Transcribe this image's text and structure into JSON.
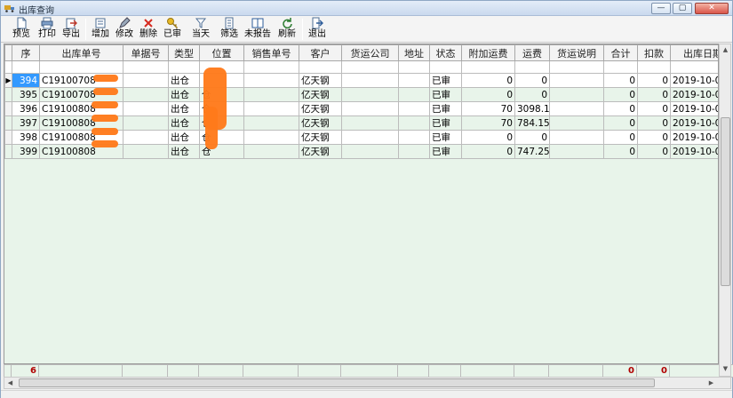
{
  "window": {
    "title": "出库查询",
    "min": "—",
    "max": "▢",
    "close": "✕"
  },
  "toolbar": {
    "preview": "预览",
    "print": "打印",
    "export": "导出",
    "add": "增加",
    "edit": "修改",
    "delete": "删除",
    "approved": "已审",
    "today": "当天",
    "filter": "筛选",
    "unreported": "未报告",
    "refresh": "刷新",
    "exit": "退出"
  },
  "colors": {
    "selection": "#3399ff",
    "row_alt": "#e8f4ea",
    "total_text": "#b00000"
  },
  "grid": {
    "headers": [
      "序",
      "出库单号",
      "单据号",
      "类型",
      "位置",
      "销售单号",
      "客户",
      "货运公司",
      "地址",
      "状态",
      "附加运费",
      "运费",
      "货运说明",
      "合计",
      "扣款",
      "出库日期"
    ],
    "rows": [
      {
        "seq": "394",
        "order": "C19100708",
        "doc": "",
        "type": "出仓",
        "loc": "",
        "sales": "",
        "customer": "亿天钢",
        "shipco": "",
        "addr": "",
        "status": "已审",
        "extra": "0",
        "freight": "0",
        "note": "",
        "total": "0",
        "deduct": "0",
        "date": "2019-10-0"
      },
      {
        "seq": "395",
        "order": "C19100708",
        "doc": "",
        "type": "出仓",
        "loc": "仓",
        "sales": "",
        "customer": "亿天钢",
        "shipco": "",
        "addr": "",
        "status": "已审",
        "extra": "0",
        "freight": "0",
        "note": "",
        "total": "0",
        "deduct": "0",
        "date": "2019-10-0"
      },
      {
        "seq": "396",
        "order": "C19100808",
        "doc": "",
        "type": "出仓",
        "loc": "仓",
        "sales": "",
        "customer": "亿天钢",
        "shipco": "",
        "addr": "",
        "status": "已审",
        "extra": "70",
        "freight": "3098.1",
        "note": "",
        "total": "0",
        "deduct": "0",
        "date": "2019-10-0"
      },
      {
        "seq": "397",
        "order": "C19100808",
        "doc": "",
        "type": "出仓",
        "loc": "仓",
        "sales": "",
        "customer": "亿天钢",
        "shipco": "",
        "addr": "",
        "status": "已审",
        "extra": "70",
        "freight": "784.15",
        "note": "",
        "total": "0",
        "deduct": "0",
        "date": "2019-10-0"
      },
      {
        "seq": "398",
        "order": "C19100808",
        "doc": "",
        "type": "出仓",
        "loc": "仓",
        "sales": "",
        "customer": "亿天钢",
        "shipco": "",
        "addr": "",
        "status": "已审",
        "extra": "0",
        "freight": "0",
        "note": "",
        "total": "0",
        "deduct": "0",
        "date": "2019-10-0"
      },
      {
        "seq": "399",
        "order": "C19100808",
        "doc": "",
        "type": "出仓",
        "loc": "仓",
        "sales": "",
        "customer": "亿天钢",
        "shipco": "",
        "addr": "",
        "status": "已审",
        "extra": "0",
        "freight": "747.25",
        "note": "",
        "total": "0",
        "deduct": "0",
        "date": "2019-10-0"
      }
    ]
  },
  "footer": {
    "count": "6",
    "total": "0",
    "deduct": "0"
  }
}
